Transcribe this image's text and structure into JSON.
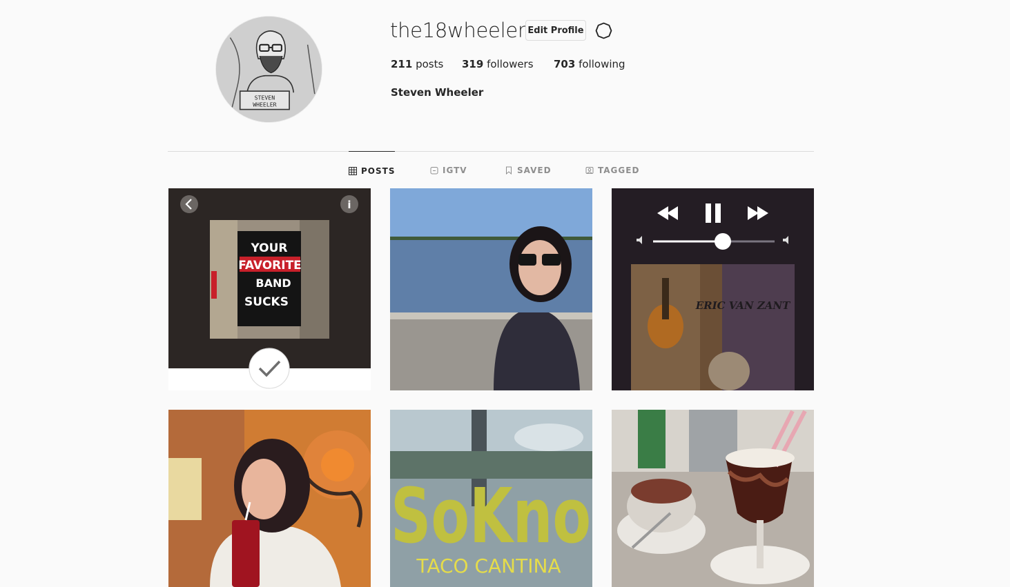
{
  "profile": {
    "username": "the18wheeler",
    "edit_label": "Edit Profile",
    "full_name": "Steven Wheeler",
    "avatar_caption": "STEVEN WHEELER",
    "stats": {
      "posts_count": "211",
      "posts_label": "posts",
      "followers_count": "319",
      "followers_label": "followers",
      "following_count": "703",
      "following_label": "following"
    }
  },
  "tabs": [
    {
      "label": "POSTS",
      "icon": "grid-icon",
      "active": true
    },
    {
      "label": "IGTV",
      "icon": "tv-icon",
      "active": false
    },
    {
      "label": "SAVED",
      "icon": "bookmark-icon",
      "active": false
    },
    {
      "label": "TAGGED",
      "icon": "tag-icon",
      "active": false
    }
  ],
  "posts": [
    {
      "text_lines": [
        "YOUR",
        "FAVORITE",
        "BAND",
        "SUCKS"
      ]
    },
    {},
    {
      "brand_text": "ERIC VAN ZANT"
    },
    {},
    {
      "sign_text": "SoKno",
      "subtitle": "TACO CANTINA"
    },
    {}
  ],
  "colors": {
    "text": "#262626",
    "muted": "#8e8e8e",
    "border": "#dbdbdb",
    "background": "#fafafa",
    "red_accent": "#c8202a"
  }
}
